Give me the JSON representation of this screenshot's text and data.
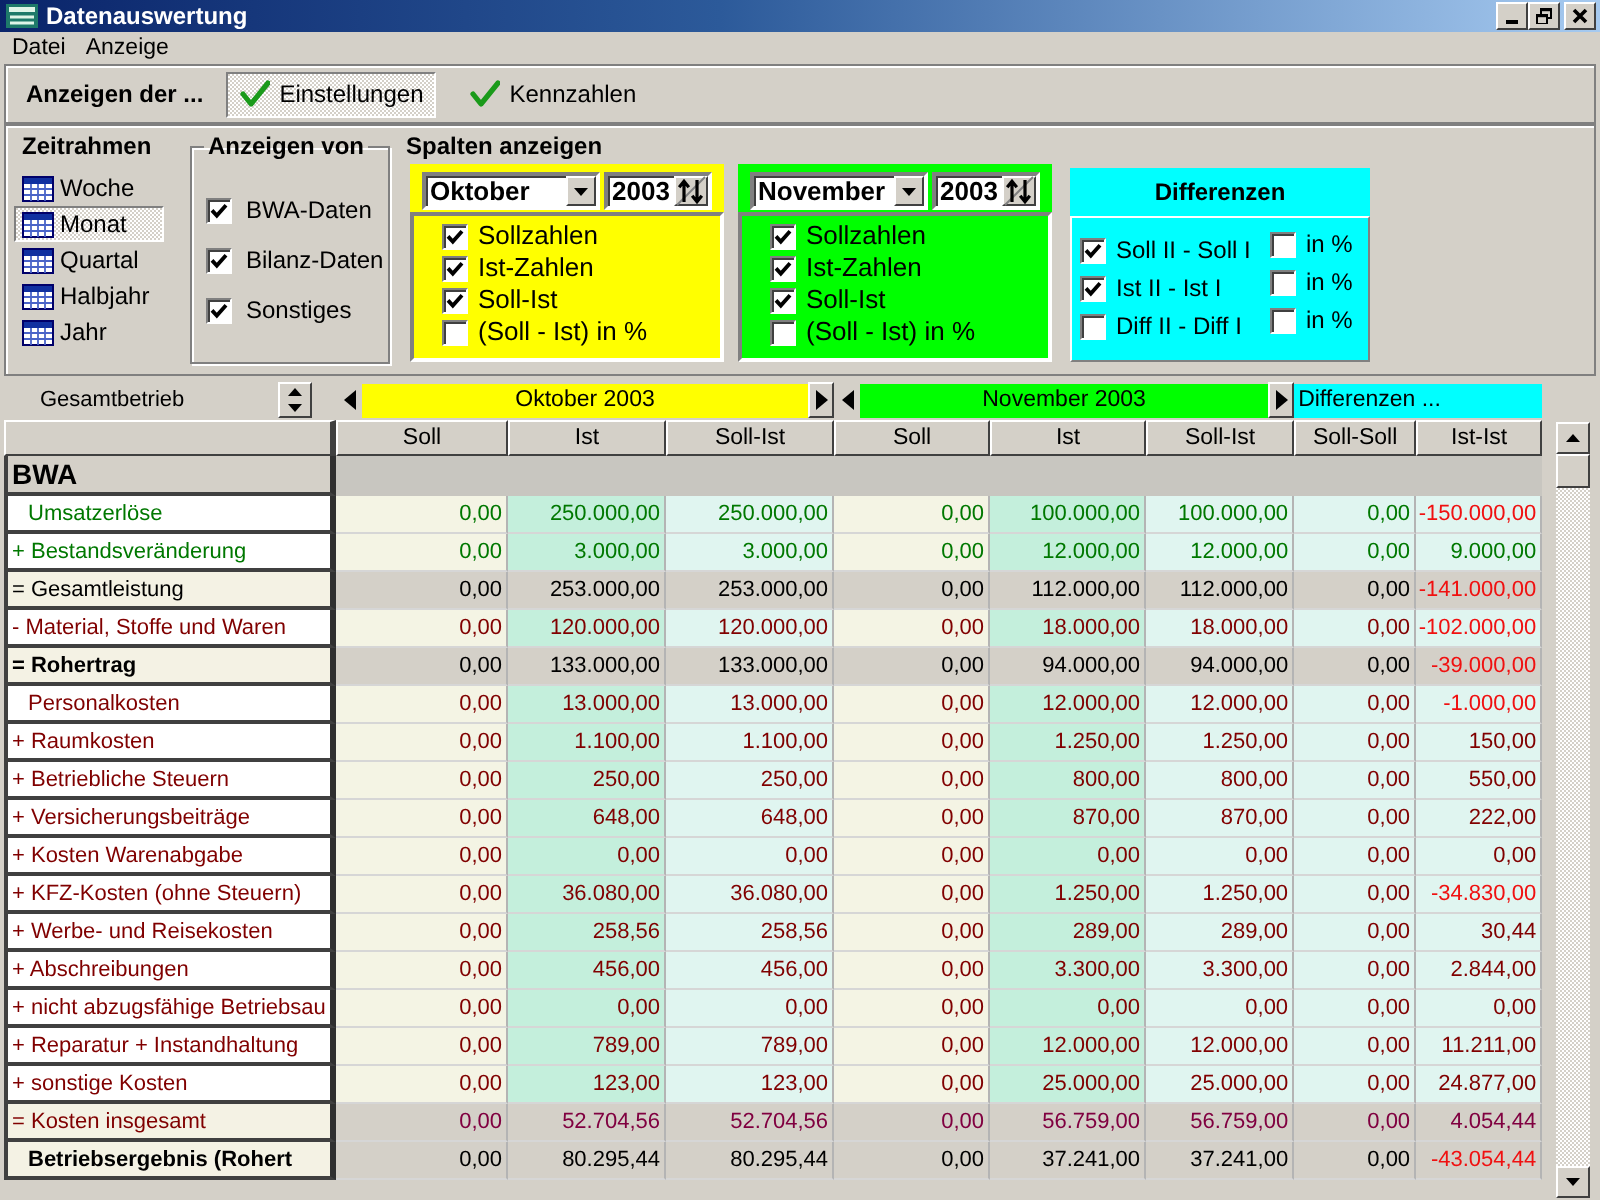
{
  "window": {
    "title": "Datenauswertung"
  },
  "menu": [
    "Datei",
    "Anzeige"
  ],
  "toolbar": {
    "label": "Anzeigen der ...",
    "buttons": [
      {
        "label": "Einstellungen",
        "selected": true
      },
      {
        "label": "Kennzahlen",
        "selected": false
      }
    ]
  },
  "timeframe": {
    "title": "Zeitrahmen",
    "items": [
      {
        "label": "Woche",
        "selected": false
      },
      {
        "label": "Monat",
        "selected": true
      },
      {
        "label": "Quartal",
        "selected": false
      },
      {
        "label": "Halbjahr",
        "selected": false
      },
      {
        "label": "Jahr",
        "selected": false
      }
    ]
  },
  "show_data": {
    "title": "Anzeigen von",
    "options": [
      {
        "label": "BWA-Daten",
        "checked": true
      },
      {
        "label": "Bilanz-Daten",
        "checked": true
      },
      {
        "label": "Sonstiges",
        "checked": true
      }
    ]
  },
  "column_settings": {
    "title": "Spalten anzeigen",
    "periods": [
      {
        "month": "Oktober",
        "year": "2003",
        "color": "#ffff00",
        "options": [
          {
            "label": "Sollzahlen",
            "checked": true
          },
          {
            "label": "Ist-Zahlen",
            "checked": true
          },
          {
            "label": "Soll-Ist",
            "checked": true
          },
          {
            "label": "(Soll - Ist) in %",
            "checked": false
          }
        ]
      },
      {
        "month": "November",
        "year": "2003",
        "color": "#00ff00",
        "options": [
          {
            "label": "Sollzahlen",
            "checked": true
          },
          {
            "label": "Ist-Zahlen",
            "checked": true
          },
          {
            "label": "Soll-Ist",
            "checked": true
          },
          {
            "label": "(Soll - Ist) in %",
            "checked": false
          }
        ]
      }
    ],
    "differences": {
      "title": "Differenzen",
      "color": "#00ffff",
      "options": [
        {
          "label": "Soll II - Soll I",
          "checked": true,
          "percent_label": "in %",
          "percent_checked": false
        },
        {
          "label": "Ist II - Ist I",
          "checked": true,
          "percent_label": "in %",
          "percent_checked": false
        },
        {
          "label": "Diff II - Diff I",
          "checked": false,
          "percent_label": "in %",
          "percent_checked": false
        }
      ]
    }
  },
  "table": {
    "scope": "Gesamtbetrieb",
    "column_groups": [
      {
        "label": "Oktober 2003",
        "color": "#ffff00",
        "arrows": true,
        "columns": [
          {
            "label": "Soll",
            "kind": "plan"
          },
          {
            "label": "Ist",
            "kind": "actual"
          },
          {
            "label": "Soll-Ist",
            "kind": "variance"
          }
        ]
      },
      {
        "label": "November 2003",
        "color": "#00ff00",
        "arrows": true,
        "columns": [
          {
            "label": "Soll",
            "kind": "plan"
          },
          {
            "label": "Ist",
            "kind": "actual"
          },
          {
            "label": "Soll-Ist",
            "kind": "variance"
          }
        ]
      },
      {
        "label": "Differenzen ...",
        "color": "#00ffff",
        "arrows": false,
        "columns": [
          {
            "label": "Soll-Soll",
            "kind": "variance"
          },
          {
            "label": "Ist-Ist",
            "kind": "variance"
          }
        ]
      }
    ],
    "sections": [
      {
        "title": "BWA",
        "rows": [
          {
            "label": "Umsatzerlöse",
            "kind": "revenue",
            "indent": true,
            "negative": true,
            "values": [
              "0,00",
              "250.000,00",
              "250.000,00",
              "0,00",
              "100.000,00",
              "100.000,00",
              "0,00",
              "-150.000,00"
            ]
          },
          {
            "label": "+ Bestandsveränderung",
            "kind": "revenue",
            "indent": false,
            "negative": false,
            "values": [
              "0,00",
              "3.000,00",
              "3.000,00",
              "0,00",
              "12.000,00",
              "12.000,00",
              "0,00",
              "9.000,00"
            ]
          },
          {
            "label": "= Gesamtleistung",
            "kind": "subtotal",
            "indent": false,
            "negative": true,
            "values": [
              "0,00",
              "253.000,00",
              "253.000,00",
              "0,00",
              "112.000,00",
              "112.000,00",
              "0,00",
              "-141.000,00"
            ]
          },
          {
            "label": "- Material, Stoffe und Waren",
            "kind": "cost",
            "indent": false,
            "negative": true,
            "values": [
              "0,00",
              "120.000,00",
              "120.000,00",
              "0,00",
              "18.000,00",
              "18.000,00",
              "0,00",
              "-102.000,00"
            ]
          },
          {
            "label": "= Rohertrag",
            "kind": "total",
            "indent": false,
            "negative": true,
            "values": [
              "0,00",
              "133.000,00",
              "133.000,00",
              "0,00",
              "94.000,00",
              "94.000,00",
              "0,00",
              "-39.000,00"
            ]
          },
          {
            "label": "Personalkosten",
            "kind": "cost",
            "indent": true,
            "negative": true,
            "values": [
              "0,00",
              "13.000,00",
              "13.000,00",
              "0,00",
              "12.000,00",
              "12.000,00",
              "0,00",
              "-1.000,00"
            ]
          },
          {
            "label": "+ Raumkosten",
            "kind": "cost",
            "indent": false,
            "negative": false,
            "values": [
              "0,00",
              "1.100,00",
              "1.100,00",
              "0,00",
              "1.250,00",
              "1.250,00",
              "0,00",
              "150,00"
            ]
          },
          {
            "label": "+ Betriebliche Steuern",
            "kind": "cost",
            "indent": false,
            "negative": false,
            "values": [
              "0,00",
              "250,00",
              "250,00",
              "0,00",
              "800,00",
              "800,00",
              "0,00",
              "550,00"
            ]
          },
          {
            "label": "+ Versicherungsbeiträge",
            "kind": "cost",
            "indent": false,
            "negative": false,
            "values": [
              "0,00",
              "648,00",
              "648,00",
              "0,00",
              "870,00",
              "870,00",
              "0,00",
              "222,00"
            ]
          },
          {
            "label": "+ Kosten Warenabgabe",
            "kind": "cost",
            "indent": false,
            "negative": false,
            "values": [
              "0,00",
              "0,00",
              "0,00",
              "0,00",
              "0,00",
              "0,00",
              "0,00",
              "0,00"
            ]
          },
          {
            "label": "+ KFZ-Kosten (ohne Steuern)",
            "kind": "cost",
            "indent": false,
            "negative": true,
            "values": [
              "0,00",
              "36.080,00",
              "36.080,00",
              "0,00",
              "1.250,00",
              "1.250,00",
              "0,00",
              "-34.830,00"
            ]
          },
          {
            "label": "+ Werbe- und Reisekosten",
            "kind": "cost",
            "indent": false,
            "negative": false,
            "values": [
              "0,00",
              "258,56",
              "258,56",
              "0,00",
              "289,00",
              "289,00",
              "0,00",
              "30,44"
            ]
          },
          {
            "label": "+ Abschreibungen",
            "kind": "cost",
            "indent": false,
            "negative": false,
            "values": [
              "0,00",
              "456,00",
              "456,00",
              "0,00",
              "3.300,00",
              "3.300,00",
              "0,00",
              "2.844,00"
            ]
          },
          {
            "label": "+ nicht abzugsfähige Betriebsau",
            "kind": "cost",
            "indent": false,
            "negative": false,
            "values": [
              "0,00",
              "0,00",
              "0,00",
              "0,00",
              "0,00",
              "0,00",
              "0,00",
              "0,00"
            ]
          },
          {
            "label": "+ Reparatur + Instandhaltung",
            "kind": "cost",
            "indent": false,
            "negative": false,
            "values": [
              "0,00",
              "789,00",
              "789,00",
              "0,00",
              "12.000,00",
              "12.000,00",
              "0,00",
              "11.211,00"
            ]
          },
          {
            "label": "+ sonstige Kosten",
            "kind": "cost",
            "indent": false,
            "negative": false,
            "values": [
              "0,00",
              "123,00",
              "123,00",
              "0,00",
              "25.000,00",
              "25.000,00",
              "0,00",
              "24.877,00"
            ]
          },
          {
            "label": "= Kosten insgesamt",
            "kind": "cost_total",
            "indent": false,
            "negative": false,
            "values": [
              "0,00",
              "52.704,56",
              "52.704,56",
              "0,00",
              "56.759,00",
              "56.759,00",
              "0,00",
              "4.054,44"
            ]
          },
          {
            "label": "Betriebsergebnis (Rohert",
            "kind": "total",
            "indent": true,
            "negative": true,
            "values": [
              "0,00",
              "80.295,44",
              "80.295,44",
              "0,00",
              "37.241,00",
              "37.241,00",
              "0,00",
              "-43.054,44"
            ]
          }
        ]
      }
    ]
  }
}
